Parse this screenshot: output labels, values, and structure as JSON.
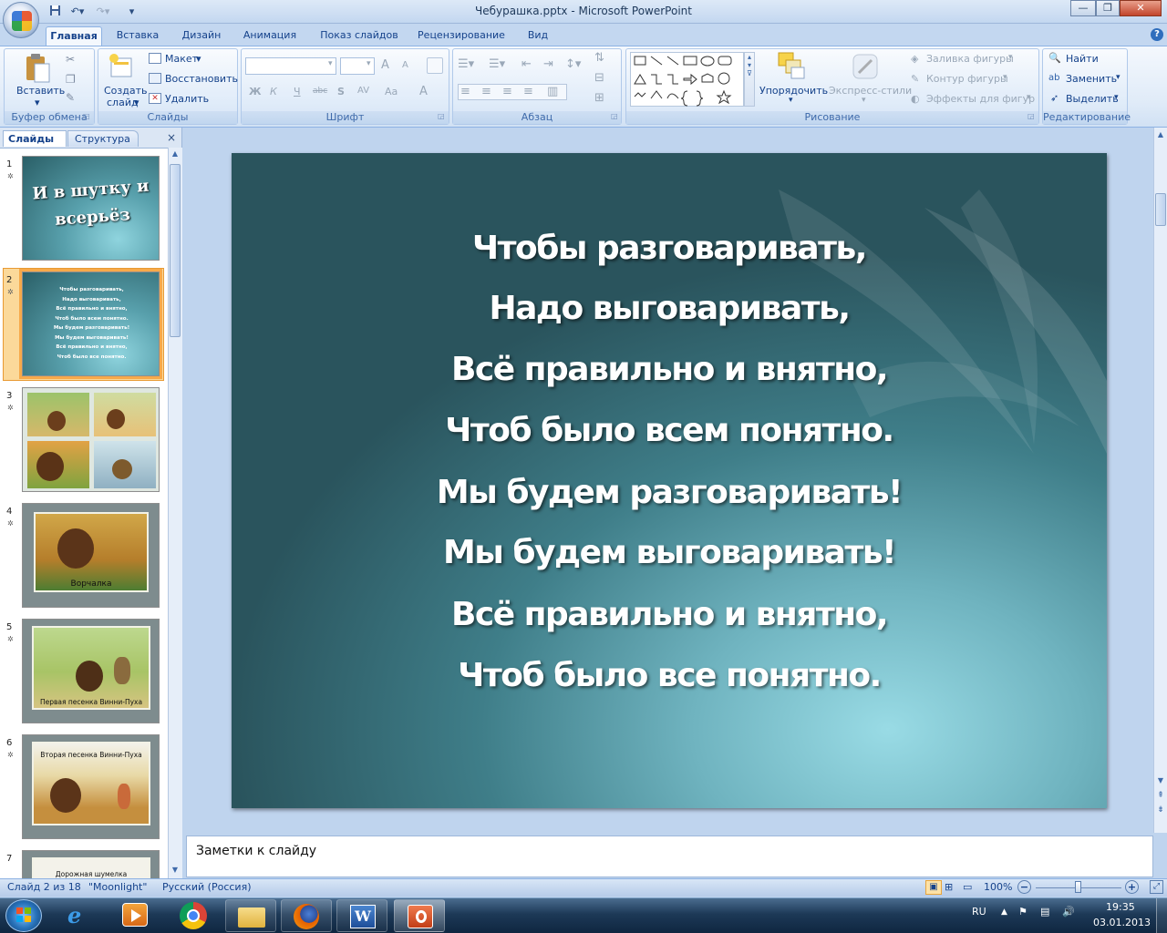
{
  "titlebar": {
    "title": "Чебурашка.pptx - Microsoft PowerPoint",
    "quick_access": [
      "save-icon",
      "undo-icon",
      "redo-icon",
      "customize-icon"
    ],
    "window_buttons": [
      "minimize",
      "maximize",
      "close"
    ]
  },
  "tabs": [
    "Главная",
    "Вставка",
    "Дизайн",
    "Анимация",
    "Показ слайдов",
    "Рецензирование",
    "Вид"
  ],
  "ribbon": {
    "clipboard": {
      "label": "Буфер обмена",
      "paste": "Вставить"
    },
    "slides": {
      "label": "Слайды",
      "new_slide_1": "Создать",
      "new_slide_2": "слайд",
      "layout": "Макет",
      "reset": "Восстановить",
      "delete": "Удалить"
    },
    "font": {
      "label": "Шрифт",
      "bold": "Ж",
      "italic": "К",
      "underline": "Ч",
      "strike": "abc",
      "shadow": "S",
      "spacing": "AV",
      "case": "Aa",
      "color": "A",
      "grow": "A",
      "shrink": "A"
    },
    "paragraph": {
      "label": "Абзац"
    },
    "drawing": {
      "label": "Рисование",
      "arrange": "Упорядочить",
      "quick_styles": "Экспресс-стили",
      "shape_fill": "Заливка фигуры",
      "shape_outline": "Контур фигуры",
      "shape_effects": "Эффекты для фигур"
    },
    "editing": {
      "label": "Редактирование",
      "find": "Найти",
      "replace": "Заменить",
      "select": "Выделить"
    }
  },
  "left_panel": {
    "tab_slides": "Слайды",
    "tab_outline": "Структура",
    "close": "×",
    "thumbnails": [
      {
        "num": "1",
        "text": "И в шутку и всерьёз"
      },
      {
        "num": "2",
        "lines": [
          "Чтобы разговаривать,",
          "Надо выговаривать,",
          "Всё правильно и внятно,",
          "Чтоб было всем понятно.",
          "Мы будем разговаривать!",
          "Мы будем выговаривать!",
          "Всё правильно и внятно,",
          "Чтоб было все понятно."
        ]
      },
      {
        "num": "3",
        "text": ""
      },
      {
        "num": "4",
        "caption": "Ворчалка"
      },
      {
        "num": "5",
        "caption": "Первая песенка Винни-Пуха"
      },
      {
        "num": "6",
        "caption": "Вторая песенка Винни-Пуха"
      },
      {
        "num": "7",
        "caption": "Дорожная шумелка"
      }
    ]
  },
  "slide": {
    "lines": [
      "Чтобы разговаривать,",
      "Надо выговаривать,",
      "Всё правильно и внятно,",
      "Чтоб было всем понятно.",
      "Мы будем разговаривать!",
      "Мы будем выговаривать!",
      "Всё правильно и внятно,",
      "Чтоб было все понятно."
    ]
  },
  "notes": {
    "text": "Заметки к слайду"
  },
  "status": {
    "slide_pos": "Слайд 2 из 18",
    "theme": "\"Moonlight\"",
    "language": "Русский (Россия)",
    "zoom": "100%",
    "zoom_level": 1.0
  },
  "taskbar": {
    "lang": "RU",
    "time": "19:35",
    "date": "03.01.2013",
    "apps": [
      "start",
      "internet-explorer",
      "media-player",
      "chrome",
      "explorer",
      "firefox",
      "word",
      "powerpoint"
    ]
  },
  "colors": {
    "ribbon_text": "#15428b",
    "selection": "#f7a94a",
    "slide_text": "#ffffff"
  }
}
